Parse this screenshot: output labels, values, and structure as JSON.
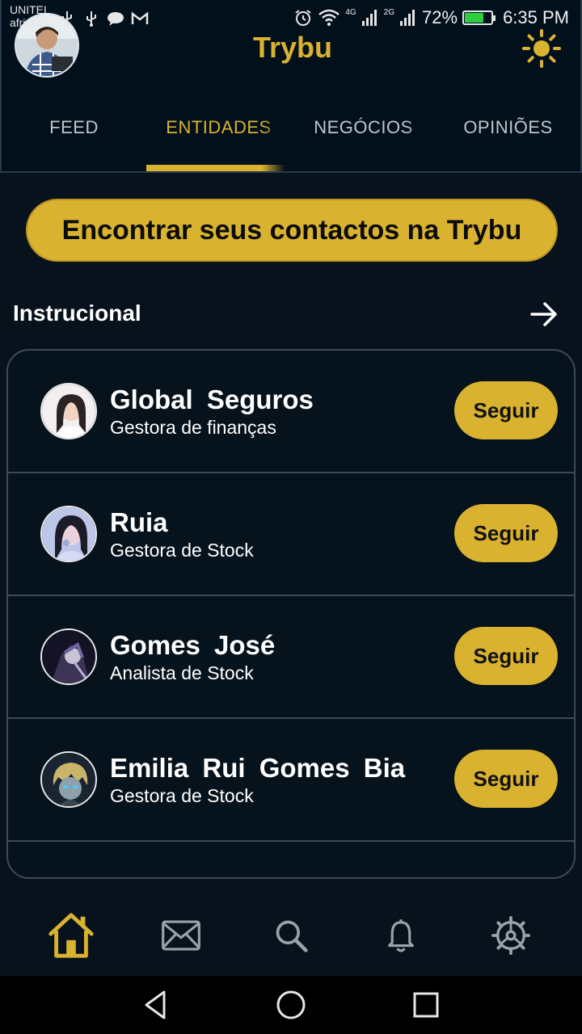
{
  "status_bar": {
    "carrier_1": "UNITEL",
    "carrier_2": "africell",
    "network_1": "4G",
    "network_2": "2G",
    "battery_percent": "72%",
    "battery_level": 0.72,
    "time": "6:35 PM",
    "icons": [
      "usb-icon",
      "usb-icon",
      "message-icon",
      "gmail-icon",
      "alarm-icon",
      "wifi-icon",
      "signal-icon",
      "signal-icon",
      "battery-icon"
    ]
  },
  "header": {
    "title": "Trybu",
    "theme_icon": "sun-icon",
    "tabs": [
      {
        "label": "FEED",
        "active": false
      },
      {
        "label": "ENTIDADES",
        "active": true
      },
      {
        "label": "NEGÓCIOS",
        "active": false
      },
      {
        "label": "OPINIÕES",
        "active": false
      }
    ]
  },
  "find_contacts": {
    "label": "Encontrar seus contactos na Trybu"
  },
  "section": {
    "title": "Instrucional",
    "arrow_icon": "arrow-right-icon"
  },
  "entities": [
    {
      "name": "Global  Seguros",
      "role": "Gestora de finanças",
      "button": "Seguir"
    },
    {
      "name": "Ruia",
      "role": "Gestora de Stock",
      "button": "Seguir"
    },
    {
      "name": "Gomes  José",
      "role": "Analista de Stock",
      "button": "Seguir"
    },
    {
      "name": "Emilia  Rui  Gomes  Bia",
      "role": "Gestora de Stock",
      "button": "Seguir"
    }
  ],
  "bottom_nav": [
    "home-icon",
    "mail-icon",
    "search-icon",
    "bell-icon",
    "settings-icon"
  ],
  "colors": {
    "accent": "#d9b22f",
    "background": "#07121d",
    "border": "#3d4a56"
  }
}
